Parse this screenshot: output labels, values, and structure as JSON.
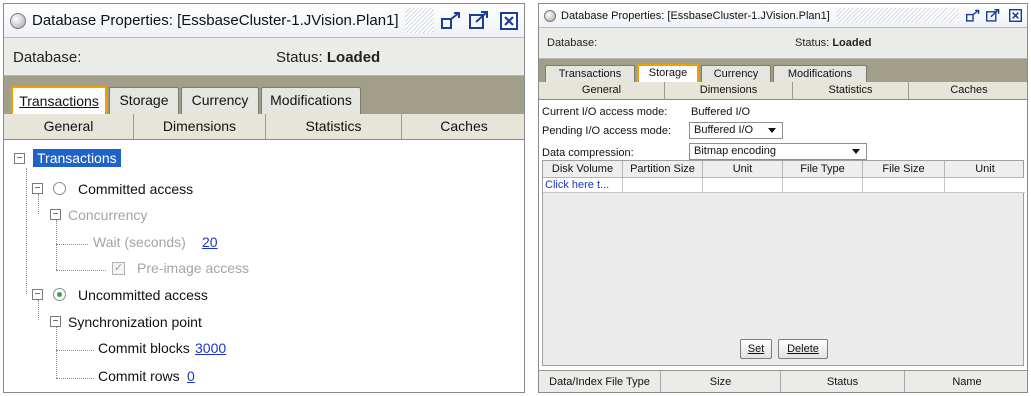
{
  "left": {
    "title": "Database Properties: [EssbaseCluster-1.JVision.Plan1]",
    "database_label": "Database:",
    "status_label": "Status:",
    "status_value": "Loaded",
    "tabs": [
      "Transactions",
      "Storage",
      "Currency",
      "Modifications"
    ],
    "active_tab": "Transactions",
    "subtabs": [
      "General",
      "Dimensions",
      "Statistics",
      "Caches"
    ],
    "tree": {
      "root": "Transactions",
      "committed_access": "Committed access",
      "concurrency": "Concurrency",
      "wait_label": "Wait (seconds)",
      "wait_value": "20",
      "pre_image": "Pre-image access",
      "uncommitted_access": "Uncommitted access",
      "sync_point": "Synchronization point",
      "commit_blocks_label": "Commit blocks",
      "commit_blocks_value": "3000",
      "commit_rows_label": "Commit rows",
      "commit_rows_value": "0"
    }
  },
  "right": {
    "title": "Database Properties: [EssbaseCluster-1.JVision.Plan1]",
    "database_label": "Database:",
    "status_label": "Status:",
    "status_value": "Loaded",
    "tabs": [
      "Transactions",
      "Storage",
      "Currency",
      "Modifications"
    ],
    "active_tab": "Storage",
    "subtabs": [
      "General",
      "Dimensions",
      "Statistics",
      "Caches"
    ],
    "current_io_label": "Current I/O access mode:",
    "current_io_value": "Buffered I/O",
    "pending_io_label": "Pending I/O access mode:",
    "pending_io_value": "Buffered I/O",
    "compression_label": "Data compression:",
    "compression_value": "Bitmap encoding",
    "grid_headers": [
      "Disk Volume",
      "Partition Size",
      "Unit",
      "File Type",
      "File Size",
      "Unit"
    ],
    "grid_first_cell": "Click here t...",
    "set_button": "Set",
    "delete_button": "Delete",
    "footer_headers": [
      "Data/Index File Type",
      "Size",
      "Status",
      "Name"
    ]
  },
  "colors": {
    "selection": "#1f62c8",
    "link": "#1a35c8",
    "active_tab_border": "#f0a000",
    "radio_on": "#38a83c"
  },
  "icons": [
    "database-icon",
    "restore-icon",
    "maximize-icon",
    "close-icon",
    "expand-minus-icon",
    "radio-icon",
    "checkbox-icon",
    "dropdown-arrow-icon"
  ]
}
